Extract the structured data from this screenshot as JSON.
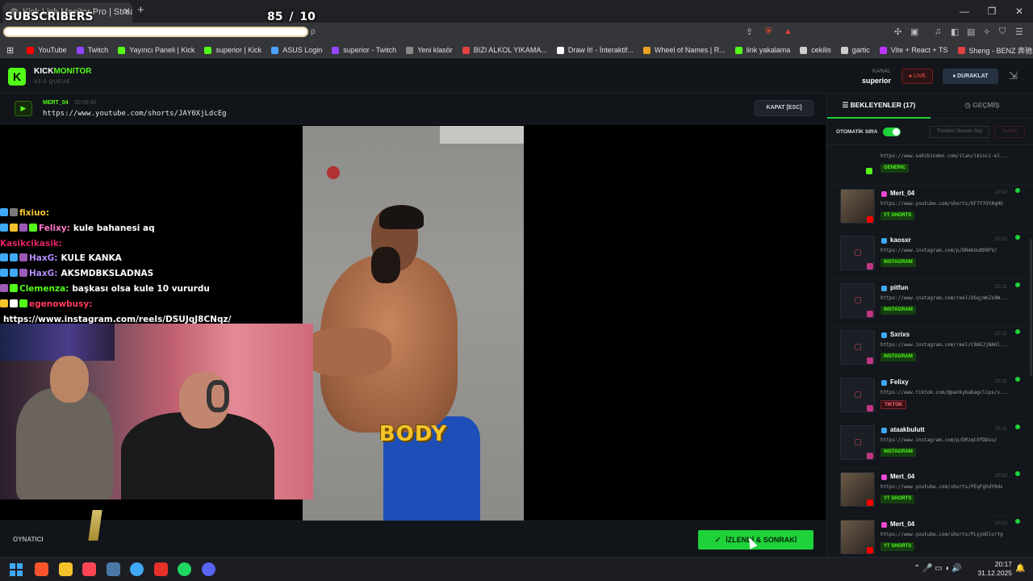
{
  "browser": {
    "tab_title": "Kick Link Monitor Pro | Stream",
    "tab_close": "✕",
    "new_tab": "+",
    "url_suffix": "p",
    "window_controls": [
      "—",
      "❐",
      "✕"
    ],
    "bookmarks": [
      {
        "label": "YouTube",
        "color": "#ff0000"
      },
      {
        "label": "Twitch",
        "color": "#9146ff"
      },
      {
        "label": "Yayıncı Paneli | Kick",
        "color": "#53fc18"
      },
      {
        "label": "superior | Kick",
        "color": "#53fc18"
      },
      {
        "label": "ASUS Login",
        "color": "#4aa3ff"
      },
      {
        "label": "superior - Twitch",
        "color": "#9146ff"
      },
      {
        "label": "Yeni klasör",
        "color": "#888888"
      },
      {
        "label": "BIZI ALKOL YIKAMA...",
        "color": "#e04040"
      },
      {
        "label": "Draw It! - İnteraktif...",
        "color": "#ffffff"
      },
      {
        "label": "Wheel of Names | R...",
        "color": "#e8a020"
      },
      {
        "label": "link yakalama",
        "color": "#53fc18"
      },
      {
        "label": "cekilis",
        "color": "#cccccc"
      },
      {
        "label": "gartic",
        "color": "#cccccc"
      },
      {
        "label": "Vite + React + TS",
        "color": "#bd34fe"
      },
      {
        "label": "Sheng - BENZ 奔驰...",
        "color": "#e04040"
      }
    ]
  },
  "overlay": {
    "subscribers_label": "SUBSCRIBERS",
    "subscribers_count": "85  / 10"
  },
  "app": {
    "logo_letter": "K",
    "logo_kick": "KICK",
    "logo_monitor": "MONITOR",
    "version": "V3.0 QUEUE",
    "channel_label": "KANAL",
    "channel_name": "superior",
    "live_label": "● LIVE",
    "pause_label": "⏸ DURAKLAT",
    "header_icon": "⇲"
  },
  "now_playing": {
    "icon": "▶",
    "user": "MERT_04",
    "time": "20:09:40",
    "url": "https://www.youtube.com/shorts/JAY0XjLdcEg",
    "close_label": "KAPAT [ESC]",
    "video_caption": "BODY"
  },
  "chat": [
    {
      "user": "fixiuo:",
      "message": "",
      "user_color": "#f4c22b",
      "badges": [
        "#3fa9f5",
        "#7a7a7a"
      ]
    },
    {
      "user": "Felixy:",
      "message": "kule bahanesi aq",
      "user_color": "#ff7ac8",
      "badges": [
        "#3fa9f5",
        "#f4c22b",
        "#9b59b6",
        "#53fc18"
      ]
    },
    {
      "user": "Kasikcikasik:",
      "message": "",
      "user_color": "#e0245e",
      "badges": []
    },
    {
      "user": "HaxG:",
      "message": "KULE KANKA",
      "user_color": "#b48cff",
      "badges": [
        "#3fa9f5",
        "#3fa9f5",
        "#9b59b6"
      ]
    },
    {
      "user": "HaxG:",
      "message": "AKSMDBKSLADNAS",
      "user_color": "#b48cff",
      "badges": [
        "#3fa9f5",
        "#3fa9f5",
        "#9b59b6"
      ]
    },
    {
      "user": "Clemenza:",
      "message": "başkası olsa kule 10 vururdu",
      "user_color": "#53fc18",
      "badges": [
        "#9b59b6",
        "#53fc18"
      ]
    },
    {
      "user": "egenowbusy:",
      "message": "",
      "user_color": "#ff3b5c",
      "badges": [
        "#f4c22b",
        "#ffffff",
        "#53fc18"
      ]
    },
    {
      "user": "",
      "message": "https://www.instagram.com/reels/DSUJqJ8CNqz/",
      "user_color": "#ffffff",
      "badges": []
    }
  ],
  "player": {
    "label": "OYNATICI",
    "watched_check": "✓",
    "watched_label": "İZLENDİ & SONRAKİ"
  },
  "side": {
    "tab_queue": "☰  BEKLEYENLER (17)",
    "tab_history": "◷  GEÇMİŞ",
    "auto_label": "OTOMATİK SIRA",
    "mark_read": "Tümünü Okundu Say",
    "clear": "Temizle",
    "queue": [
      {
        "user": "",
        "time": "",
        "url": "https://www.sahibinden.com/ilan/ikinci-el...",
        "tag": "GENERIC",
        "tag_class": "tag-generic",
        "platform_color": "#53fc18",
        "thumb": "generic"
      },
      {
        "user": "Mert_04",
        "time": "20:12",
        "url": "https://www.youtube.com/shorts/bF7Y7OYAqHU",
        "tag": "YT SHORTS",
        "tag_class": "tag-yt",
        "platform_color": "#e84ad0",
        "thumb": "image"
      },
      {
        "user": "kaosxr",
        "time": "20:12",
        "url": "https://www.instagram.com/p/DRmkUuDD9FV/",
        "tag": "INSTAGRAM",
        "tag_class": "tag-ig",
        "platform_color": "#3fa9f5",
        "thumb": "ig"
      },
      {
        "user": "pitfun",
        "time": "20:11",
        "url": "https://www.instagram.com/reel/DGqjmKZs9W...",
        "tag": "INSTAGRAM",
        "tag_class": "tag-ig",
        "platform_color": "#3fa9f5",
        "thumb": "ig"
      },
      {
        "user": "Sxrixs",
        "time": "20:11",
        "url": "https://www.instagram.com/reel/C8AEJjNAGl...",
        "tag": "INSTAGRAM",
        "tag_class": "tag-ig",
        "platform_color": "#3fa9f5",
        "thumb": "ig"
      },
      {
        "user": "Felixy",
        "time": "20:11",
        "url": "https://www.tiktok.com/@pankybabagclips/v...",
        "tag": "TIKTOK",
        "tag_class": "tag-tt",
        "platform_color": "#3fa9f5",
        "thumb": "tt"
      },
      {
        "user": "ataakbulutt",
        "time": "20:11",
        "url": "https://www.instagram.com/p/DRzqC0fDDsu/",
        "tag": "INSTAGRAM",
        "tag_class": "tag-ig",
        "platform_color": "#3fa9f5",
        "thumb": "ig"
      },
      {
        "user": "Mert_04",
        "time": "20:10",
        "url": "https://www.youtube.com/shorts/PEqFghdY9ds",
        "tag": "YT SHORTS",
        "tag_class": "tag-yt",
        "platform_color": "#e84ad0",
        "thumb": "image"
      },
      {
        "user": "Mert_04",
        "time": "20:10",
        "url": "https://www.youtube.com/shorts/PLyyUGlorYg",
        "tag": "YT SHORTS",
        "tag_class": "tag-yt",
        "platform_color": "#e84ad0",
        "thumb": "image"
      }
    ]
  },
  "taskbar": {
    "apps": [
      {
        "name": "brave",
        "color": "#fb542b"
      },
      {
        "name": "files",
        "color": "#f4c22b"
      },
      {
        "name": "valorant",
        "color": "#ff4655"
      },
      {
        "name": "steam",
        "color": "#4a78a8"
      },
      {
        "name": "app5",
        "color": "#3fa9f5"
      },
      {
        "name": "app6",
        "color": "#e8302b"
      },
      {
        "name": "spotify",
        "color": "#1ed760"
      },
      {
        "name": "discord",
        "color": "#5865f2"
      }
    ],
    "tray": "⌃   🎤   ▭ ◖ 🔊",
    "time": "20:17",
    "date": "31.12.2025",
    "notif": "🔔"
  }
}
